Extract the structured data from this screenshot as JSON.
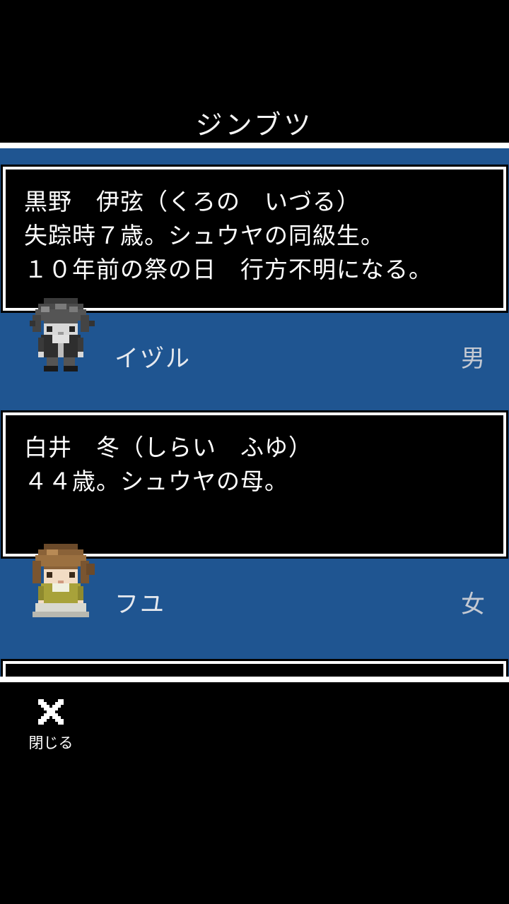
{
  "screen": {
    "title": "ジンブツ"
  },
  "characters": [
    {
      "description_lines": [
        "黒野　伊弦（くろの　いづる）",
        "失踪時７歳。シュウヤの同級生。",
        "１０年前の祭の日　行方不明になる。"
      ],
      "name": "イヅル",
      "sex": "男",
      "sprite": "boy-gray-hair-sprite"
    },
    {
      "description_lines": [
        "白井　冬（しらい　ふゆ）",
        "４４歳。シュウヤの母。"
      ],
      "name": "フユ",
      "sex": "女",
      "sprite": "woman-brown-hair-sprite"
    }
  ],
  "footer": {
    "close_label": "閉じる",
    "close_icon": "close-x-icon"
  },
  "colors": {
    "background": "#000000",
    "list_blue": "#1f5591",
    "box_border": "#ffffff",
    "text": "#ffffff"
  }
}
